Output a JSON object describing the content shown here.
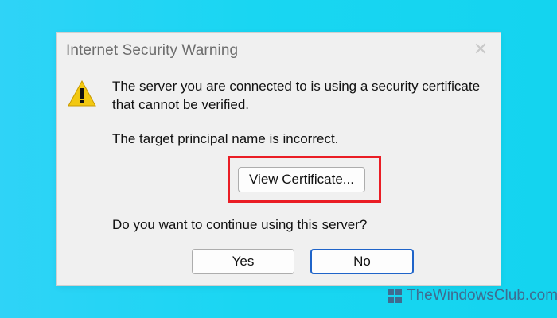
{
  "dialog": {
    "title": "Internet Security Warning",
    "icons": {
      "close": "close-icon",
      "warning": "warning-icon"
    },
    "message1": "The server you are connected to is using a security certificate that cannot be verified.",
    "message2": "The target principal name is incorrect.",
    "question": "Do you want to continue using this server?",
    "buttons": {
      "view_certificate": "View Certificate...",
      "yes": "Yes",
      "no": "No"
    }
  },
  "watermark": {
    "text": "TheWindowsClub.com"
  },
  "colors": {
    "background": "#14d4ef",
    "highlight": "#ea1d25",
    "default_button_border": "#1f64c9",
    "warning_icon": "#f2c811"
  }
}
